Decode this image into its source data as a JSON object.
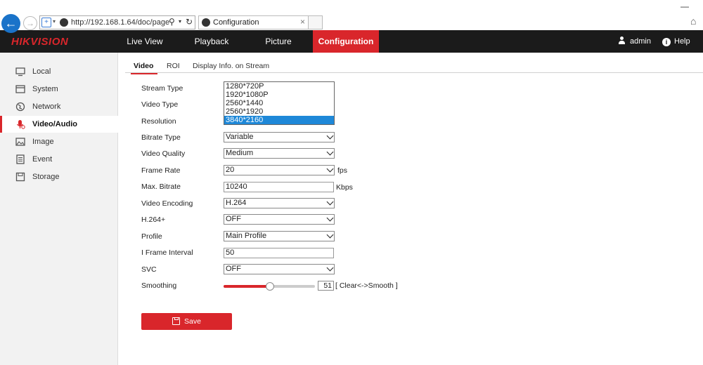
{
  "browser": {
    "url": "http://192.168.1.64/doc/page",
    "tab_title": "Configuration",
    "tab_close": "×"
  },
  "nav": {
    "logo_part1": "HIK",
    "logo_part2": "VISION",
    "items": [
      "Live View",
      "Playback",
      "Picture",
      "Configuration"
    ],
    "active": "Configuration",
    "user": "admin",
    "help": "Help"
  },
  "sidebar": {
    "items": [
      {
        "label": "Local",
        "icon": "monitor-icon"
      },
      {
        "label": "System",
        "icon": "system-icon"
      },
      {
        "label": "Network",
        "icon": "globe-icon"
      },
      {
        "label": "Video/Audio",
        "icon": "microphone-icon"
      },
      {
        "label": "Image",
        "icon": "image-icon"
      },
      {
        "label": "Event",
        "icon": "event-list-icon"
      },
      {
        "label": "Storage",
        "icon": "disk-icon"
      }
    ],
    "active": "Video/Audio"
  },
  "subtabs": [
    "Video",
    "ROI",
    "Display Info. on Stream"
  ],
  "form": {
    "labels": {
      "stream_type": "Stream Type",
      "video_type": "Video Type",
      "resolution": "Resolution",
      "bitrate_type": "Bitrate Type",
      "video_quality": "Video Quality",
      "frame_rate": "Frame Rate",
      "max_bitrate": "Max. Bitrate",
      "video_encoding": "Video Encoding",
      "h264plus": "H.264+",
      "profile": "Profile",
      "i_frame_interval": "I Frame Interval",
      "svc": "SVC",
      "smoothing": "Smoothing"
    },
    "resolution_options": [
      "1280*720P",
      "1920*1080P",
      "2560*1440",
      "2560*1920",
      "3840*2160"
    ],
    "resolution_selected": "3840*2160",
    "bitrate_type": "Variable",
    "video_quality": "Medium",
    "frame_rate": "20",
    "frame_rate_unit": "fps",
    "max_bitrate": "10240",
    "max_bitrate_unit": "Kbps",
    "video_encoding": "H.264",
    "h264plus": "OFF",
    "profile": "Main Profile",
    "i_frame_interval": "50",
    "svc": "OFF",
    "smoothing": 51,
    "smoothing_hint": "[ Clear<->Smooth ]",
    "save_label": "Save"
  },
  "colors": {
    "accent": "#d9262b",
    "nav_bg": "#1b1b1b",
    "sidebar_bg": "#f2f2f2",
    "dropdown_selected": "#1e88d8"
  }
}
